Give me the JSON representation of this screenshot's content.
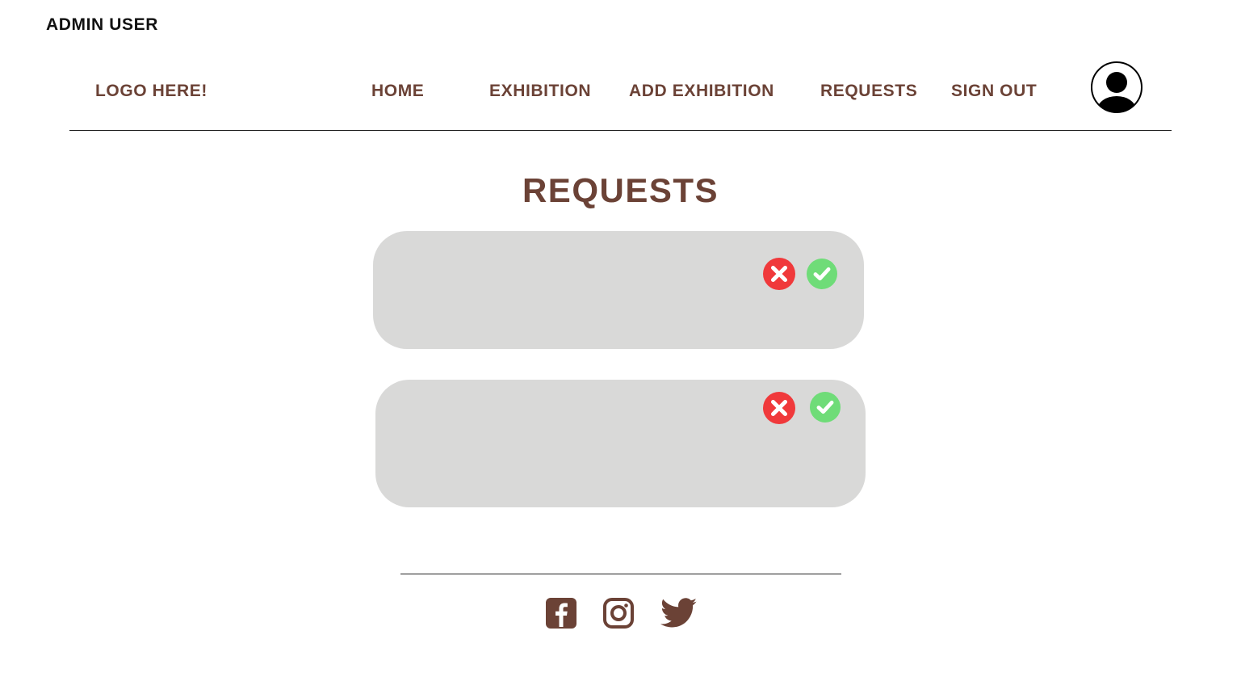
{
  "header": {
    "admin_label": "ADMIN USER",
    "logo_text": "LOGO HERE!",
    "nav": {
      "home": "HOME",
      "exhibition": "EXHIBITION",
      "add_exhibition": "ADD EXHIBITION",
      "requests": "REQUESTS",
      "sign_out": "SIGN OUT"
    },
    "avatar_icon": "user-avatar-icon"
  },
  "main": {
    "title": "REQUESTS",
    "requests": [
      {
        "reject_icon": "reject-x-icon",
        "approve_icon": "approve-check-icon"
      },
      {
        "reject_icon": "reject-x-icon",
        "approve_icon": "approve-check-icon"
      }
    ]
  },
  "footer": {
    "social_icons": [
      "facebook-icon",
      "instagram-icon",
      "twitter-icon"
    ]
  },
  "colors": {
    "brand_brown": "#6b4236",
    "card_gray": "#d9d9d8",
    "reject_red": "#f0393b",
    "approve_green": "#6fdc78",
    "text_dark": "#111111"
  }
}
